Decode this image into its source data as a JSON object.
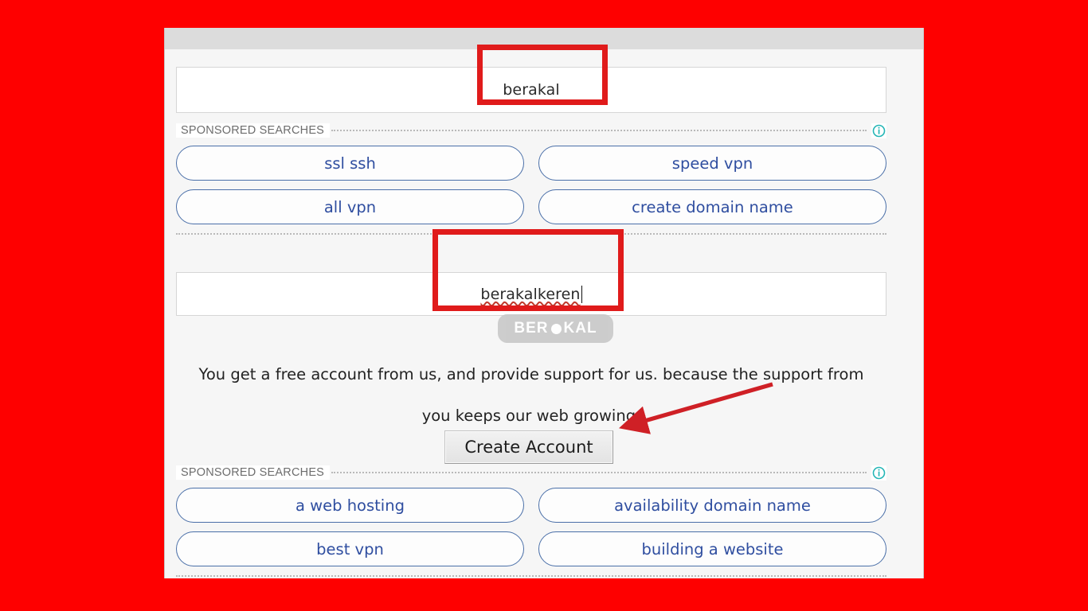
{
  "annotation": {
    "highlight_color": "#e01b1b",
    "frame_color": "#fe0000",
    "arrow_color": "#cf2026",
    "box_1_target": "berakal",
    "box_2_target": "berakalkeren",
    "arrow_target": "Create Account"
  },
  "search_top": {
    "value": "berakal",
    "placeholder": ""
  },
  "sponsored_top": {
    "label": "SPONSORED SEARCHES",
    "info_icon": "info-icon",
    "ads": [
      "ssl ssh",
      "speed vpn",
      "all vpn",
      "create domain name"
    ]
  },
  "search_second": {
    "value": "berakalkeren",
    "placeholder": "",
    "spellcheck_error": true,
    "caret_visible": true
  },
  "watermark": {
    "text_left": "BER",
    "text_right": "KAL",
    "full_text": "BERAKAL"
  },
  "promo": {
    "line_1": "You get a free account from us, and provide support for us. because the support from",
    "line_2": "you keeps our web growing."
  },
  "create_account": {
    "label": "Create Account"
  },
  "sponsored_bottom": {
    "label": "SPONSORED SEARCHES",
    "info_icon": "info-icon",
    "ads": [
      "a web hosting",
      "availability domain name",
      "best vpn",
      "building a website"
    ]
  },
  "colors": {
    "ad_text": "#2f4ea0",
    "ad_border": "#4a6fa8",
    "info_icon": "#25b6b6",
    "panel_bg": "#f6f6f6",
    "panel_header_bg": "#dcdcdc"
  }
}
